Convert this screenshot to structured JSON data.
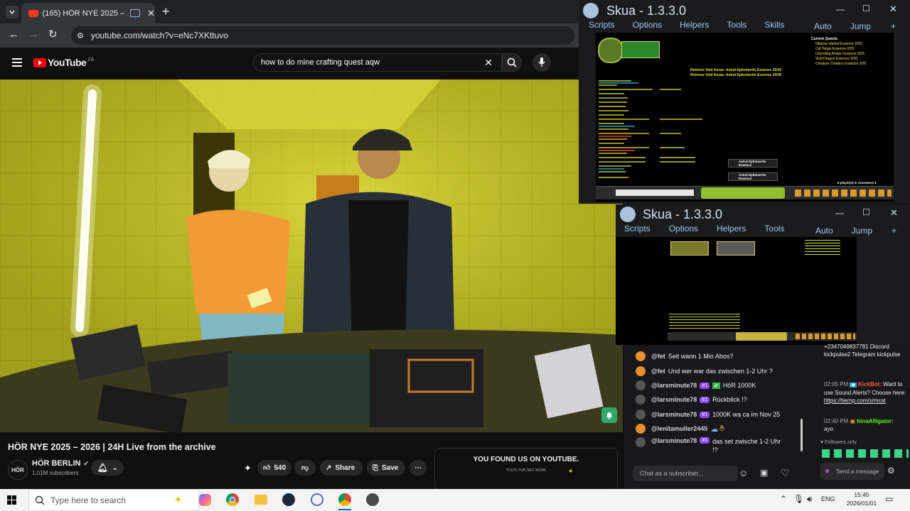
{
  "browser": {
    "tab_title": "(165) HÖR NYE 2025 – 202…",
    "url": "youtube.com/watch?v=eNc7XKttuvo"
  },
  "youtube": {
    "logo_text": "YouTube",
    "region": "ZA",
    "search_query": "how to do mine crafting quest aqw",
    "video_title": "HÖR NYE 2025 – 2026 | 24H Live from the archive",
    "channel_name": "HÖR BERLIN",
    "channel_avatar_text": "HÖR",
    "subscribers": "1.01M subscribers",
    "likes": "540",
    "share_label": "Share",
    "save_label": "Save",
    "promo_title": "YOU FOUND US ON YOUTUBE.",
    "promo_sub": "YOU'D OUR SEO WORK"
  },
  "skua_windows": [
    {
      "title": "Skua - 1.3.3.0",
      "menu": [
        "Scripts",
        "Options",
        "Helpers",
        "Tools",
        "Skills"
      ],
      "auto": "Auto",
      "jump": "Jump",
      "quest_header": "Current Quests:",
      "quests": [
        "Obsess Voided Essence 0/20,",
        "Cal Tango Essence 0/20,",
        "Unending Avatar Essence 0/20,",
        "Void Dragon Essence 0/20,",
        "Creature Creation Essence 0/20"
      ],
      "green_1": "Retrieve Void Auras: Astral Ephemerite Essence 20/20",
      "green_2": "Retrieve Void Auras: Astral Ephemerite Essence 20/20",
      "drop_1": "Astral Ephemerite Essence",
      "drop_2": "Astral Ephemerite Essence",
      "players": "8 player(s) in Ancestors-1"
    },
    {
      "title": "Skua - 1.3.3.0",
      "menu": [
        "Scripts",
        "Options",
        "Helpers",
        "Tools"
      ],
      "auto": "Auto",
      "jump": "Jump"
    }
  ],
  "chat": {
    "messages": [
      {
        "user": "@fet",
        "text": "Seit wann 1 Mio Abos?",
        "badge": "",
        "avatar_color": "#e8902a"
      },
      {
        "user": "@fet",
        "text": "Und wer war das zwischen 1-2 Uhr ?",
        "badge": "",
        "avatar_color": "#e8902a"
      },
      {
        "user": "@larsminute78",
        "text": "HöR 1000K",
        "badge": "#1",
        "avatar_color": "#555"
      },
      {
        "user": "@larsminute78",
        "text": "Rückblick !?",
        "badge": "#1",
        "avatar_color": "#555"
      },
      {
        "user": "@larsminute78",
        "text": "1000K wa ca im Nov 25",
        "badge": "#1",
        "avatar_color": "#555"
      },
      {
        "user": "@lenitamuller2445",
        "text": "",
        "badge": "",
        "avatar_color": "#e8902a"
      },
      {
        "user": "@larsminute78",
        "text": "das set zwische 1-2 Uhr !?",
        "badge": "#1",
        "avatar_color": "#555"
      }
    ],
    "input_placeholder": "Chat as a subscriber...",
    "side_top": "+2347049837781 Discord kickpulse2 Telegram kickpulse",
    "side_msg1_time": "02:05 PM",
    "side_msg1_user": "KickBot:",
    "side_msg1_text": "Want to use Sound Alerts? Choose here:",
    "side_msg1_link": "https://tiernp.com/x/mcst",
    "side_msg2_time": "02:40 PM",
    "side_msg2_user": "hinaAlligator:",
    "side_msg2_text": "ayo",
    "followers_only": "Followers only",
    "send_label": "Send a message"
  },
  "taskbar": {
    "search_placeholder": "Type here to search",
    "lang": "ENG",
    "time": "15:45",
    "date": "2026/01/01"
  },
  "colors": {
    "yt_red": "#ff0000",
    "skua_blue": "#9cc8f2",
    "twitch_purple": "#9147ff",
    "green_text": "#d7e81c"
  }
}
